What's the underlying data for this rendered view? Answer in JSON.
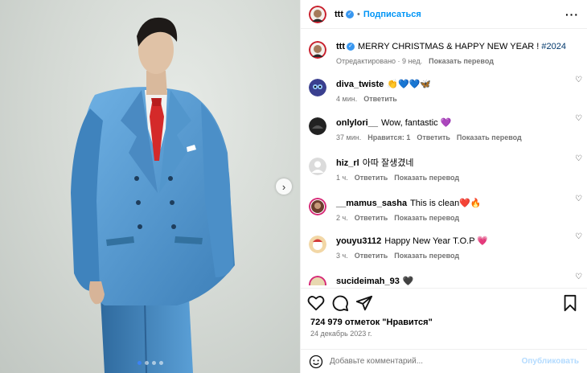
{
  "post": {
    "username": "ttt",
    "subscribe_label": "Подписаться",
    "separator": "•",
    "more_label": "···"
  },
  "caption": {
    "username": "ttt",
    "text": "MERRY CHRISTMAS & HAPPY NEW YEAR ! ",
    "hashtag": "#2024",
    "edited": "Отредактировано · 9 нед.",
    "translate": "Показать перевод"
  },
  "comments": [
    {
      "user": "diva_twiste",
      "text": "👏💙💙🦋",
      "time": "4 мин.",
      "actions": [
        "Ответить"
      ]
    },
    {
      "user": "onlylori__",
      "text": "Wow, fantastic 💜",
      "time": "37 мин.",
      "actions": [
        "Нравится: 1",
        "Ответить",
        "Показать перевод"
      ]
    },
    {
      "user": "hiz_rl",
      "text": "아따 잘생겼네",
      "time": "1 ч.",
      "actions": [
        "Ответить",
        "Показать перевод"
      ]
    },
    {
      "user": "__mamus_sasha",
      "text": "This is clean❤️🔥",
      "time": "2 ч.",
      "actions": [
        "Ответить",
        "Показать перевод"
      ]
    },
    {
      "user": "youyu3112",
      "text": "Happy New Year T.O.P 💗",
      "time": "3 ч.",
      "actions": [
        "Ответить",
        "Показать перевод"
      ]
    },
    {
      "user": "sucideimah_93",
      "text": "🖤",
      "time": "",
      "actions": []
    }
  ],
  "likes": "724 979 отметок \"Нравится\"",
  "date": "24 декабрь 2023 г.",
  "composer": {
    "placeholder": "Добавьте комментарий...",
    "publish": "Опубликовать"
  },
  "carousel": {
    "dots": 4,
    "active_index": 0
  },
  "colors": {
    "suit": "#5b9fd6",
    "tie": "#d42a2a",
    "verified": "#3897f0",
    "link": "#0095f6",
    "hashtag": "#00376b"
  },
  "icons": [
    "heart-icon",
    "comment-icon",
    "share-icon",
    "bookmark-icon",
    "smile-icon",
    "more-icon",
    "chevron-right-icon",
    "verified-icon"
  ]
}
